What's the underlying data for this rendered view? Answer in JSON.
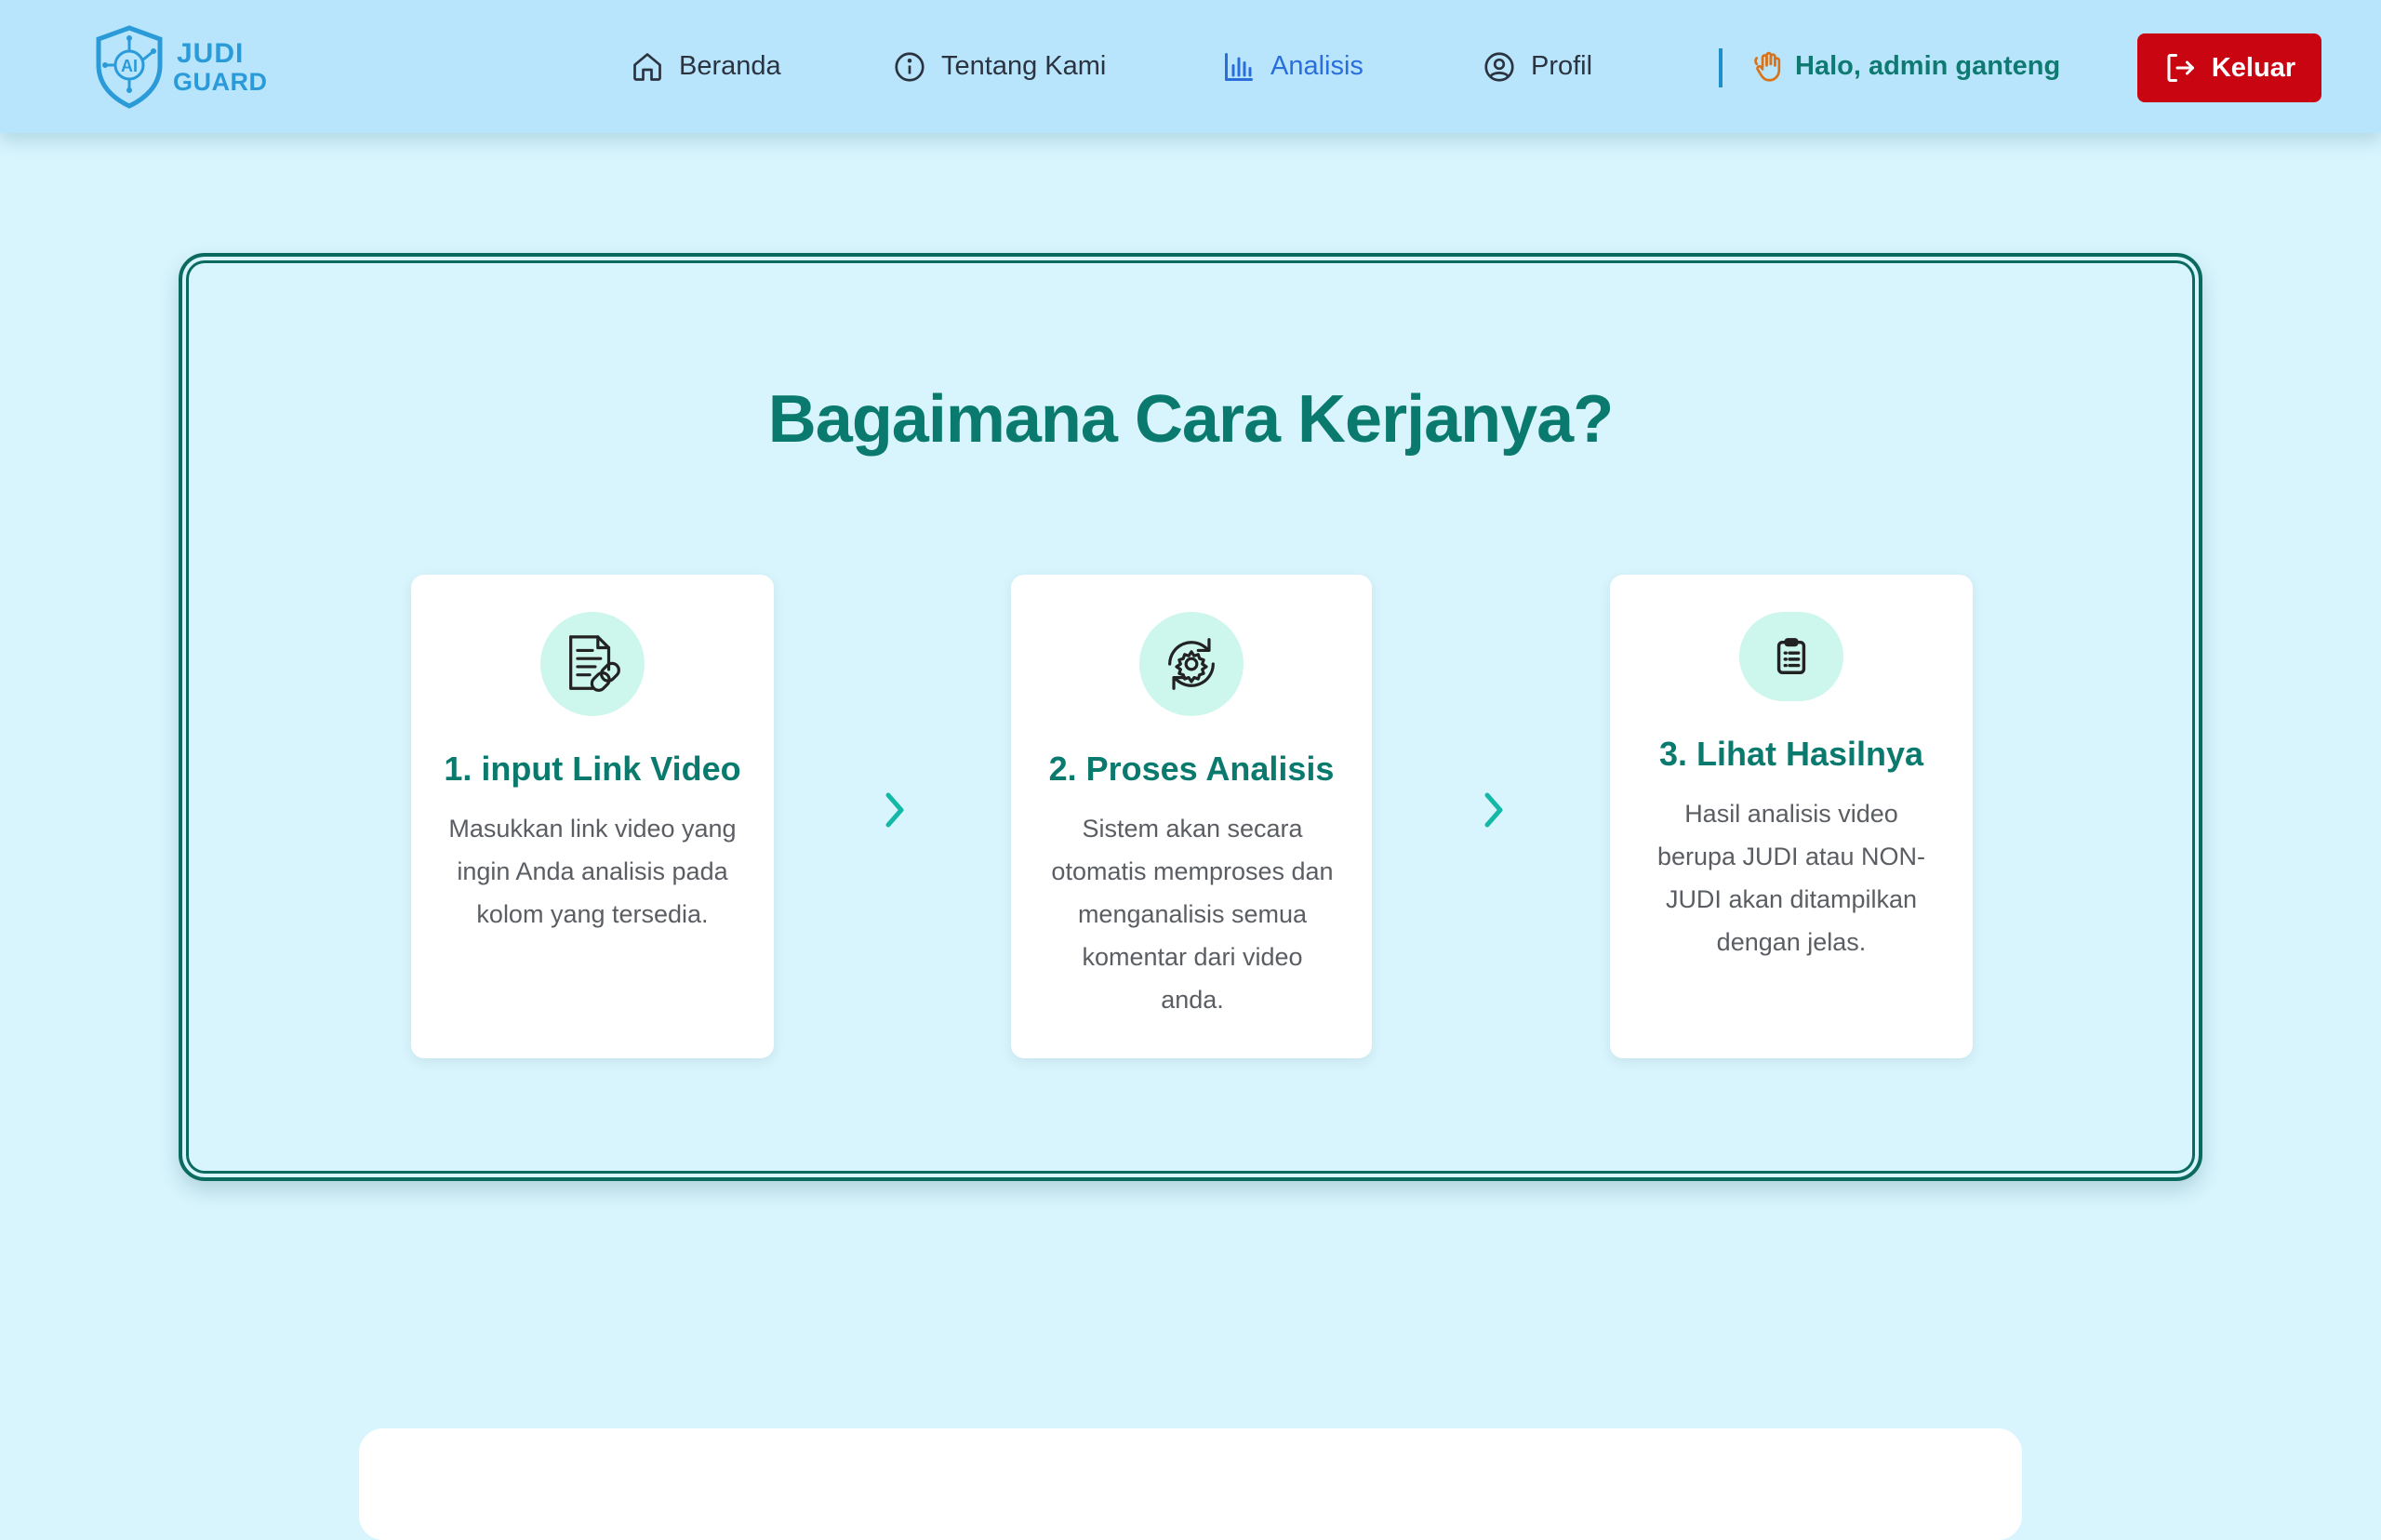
{
  "brand": {
    "line1": "JUDI",
    "line2": "GUARD",
    "badge": "AI",
    "icon": "shield-ai-logo"
  },
  "nav": {
    "items": [
      {
        "label": "Beranda",
        "icon": "home-icon"
      },
      {
        "label": "Tentang Kami",
        "icon": "info-icon"
      },
      {
        "label": "Analisis",
        "icon": "bar-chart-icon",
        "active": true
      },
      {
        "label": "Profil",
        "icon": "user-circle-icon"
      }
    ],
    "greeting": "Halo, admin ganteng",
    "logout_label": "Keluar"
  },
  "how": {
    "title": "Bagaimana Cara Kerjanya?",
    "steps": [
      {
        "title": "1. input Link Video",
        "text": "Masukkan link video yang ingin Anda analisis pada kolom yang tersedia.",
        "icon": "document-link-icon"
      },
      {
        "title": "2. Proses Analisis",
        "text": "Sistem akan secara otomatis memproses dan menganalisis semua komentar dari video anda.",
        "icon": "gear-refresh-icon"
      },
      {
        "title": "3. Lihat Hasilnya",
        "text": "Hasil analisis video berupa JUDI atau NON-JUDI akan ditampilkan dengan jelas.",
        "icon": "clipboard-list-icon"
      }
    ]
  },
  "colors": {
    "navbar": "#b8e5fb",
    "page": "#d8f5fd",
    "accent_teal": "#0b7a6e",
    "active_nav": "#2a6edb",
    "logout": "#c80510"
  }
}
